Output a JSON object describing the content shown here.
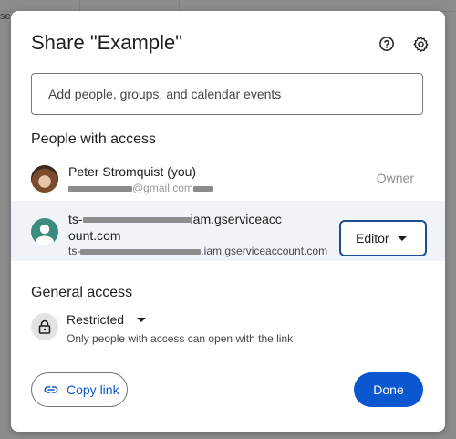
{
  "background": {
    "corner_text": "se"
  },
  "dialog": {
    "title": "Share \"Example\"",
    "help_icon": "help-circle-icon",
    "settings_icon": "gear-icon"
  },
  "add_people": {
    "placeholder": "Add people, groups, and calendar events"
  },
  "people_with_access": {
    "heading": "People with access",
    "owner": {
      "name": "Peter Stromquist (you)",
      "email_suffix": "@gmail.com",
      "role": "Owner"
    },
    "editor": {
      "name_prefix": "ts-",
      "name_suffix_line1": "iam.gserviceacc",
      "name_line2": "ount.com",
      "email_prefix": "ts-",
      "email_suffix": ".iam.gserviceaccount.com",
      "role": "Editor"
    }
  },
  "general_access": {
    "heading": "General access",
    "selected": "Restricted",
    "description": "Only people with access can open with the link"
  },
  "footer": {
    "copy_link_label": "Copy link",
    "done_label": "Done"
  },
  "colors": {
    "primary": "#0b57d0",
    "focus_border": "#1c4f8f",
    "row_highlight": "#f0f4f9",
    "avatar_green": "#3d8b7d"
  }
}
